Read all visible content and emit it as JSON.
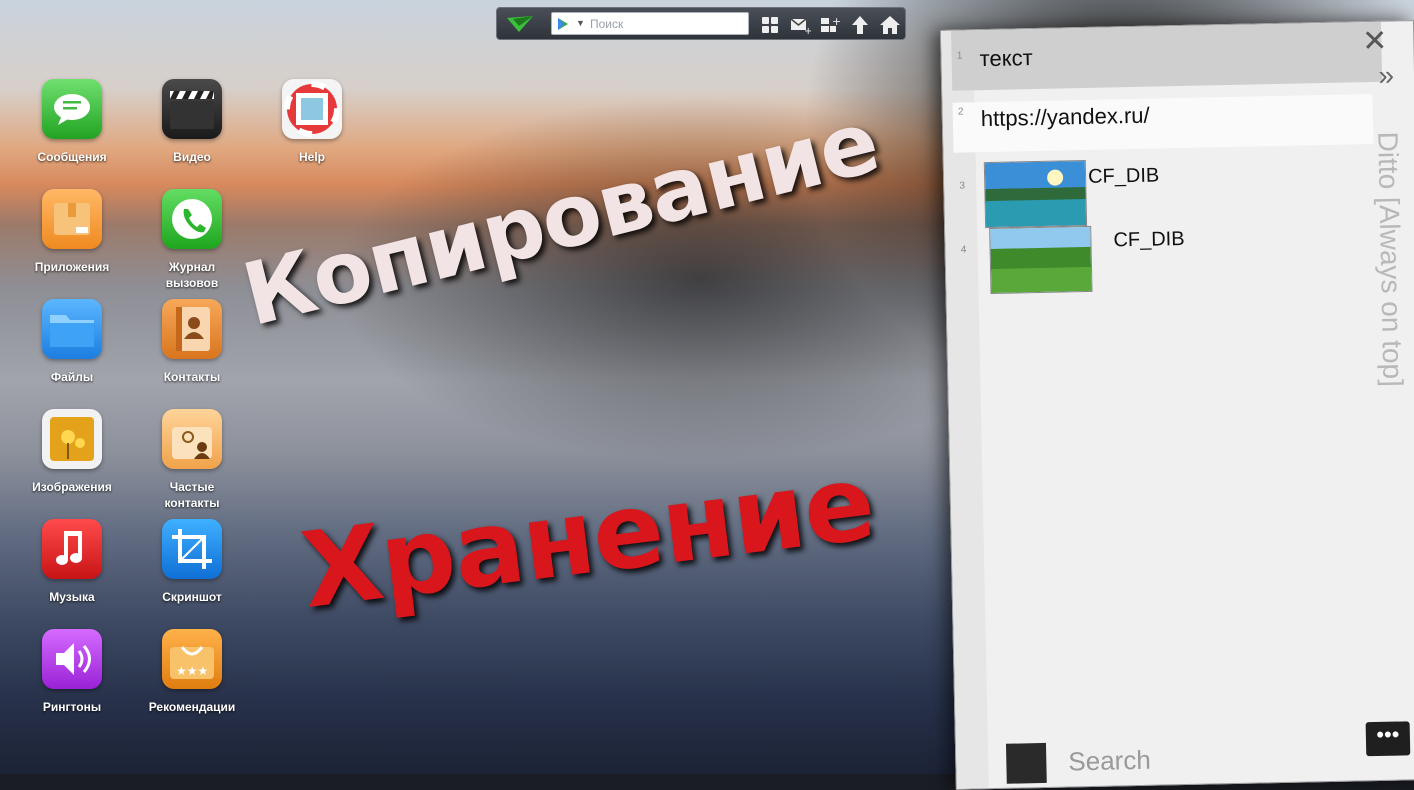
{
  "toolbar": {
    "search_placeholder": "Поиск"
  },
  "apps": [
    {
      "label": "Сообщения",
      "icon": "messages-icon"
    },
    {
      "label": "Видео",
      "icon": "video-clapper-icon"
    },
    {
      "label": "Help",
      "icon": "lifebuoy-icon"
    },
    {
      "label": "Приложения",
      "icon": "app-box-icon"
    },
    {
      "label": "Журнал\nвызовов",
      "icon": "phone-icon"
    },
    {
      "label": "Файлы",
      "icon": "folder-icon"
    },
    {
      "label": "Контакты",
      "icon": "contacts-book-icon"
    },
    {
      "label": "Изображения",
      "icon": "photos-icon"
    },
    {
      "label": "Частые\nконтакты",
      "icon": "frequent-contacts-icon"
    },
    {
      "label": "Музыка",
      "icon": "music-note-icon"
    },
    {
      "label": "Скриншот",
      "icon": "crop-icon"
    },
    {
      "label": "Рингтоны",
      "icon": "speaker-icon"
    },
    {
      "label": "Рекомендации",
      "icon": "basket-icon"
    }
  ],
  "headline": {
    "line1": "Копирование",
    "line2": "Хранение",
    "line1_color": "#f2e4e4",
    "line2_color": "#d8161c"
  },
  "ditto": {
    "title": "Ditto [Always on top]",
    "items": [
      {
        "num": "1",
        "text": "текст"
      },
      {
        "num": "2",
        "text": "https://yandex.ru/"
      },
      {
        "num": "3",
        "text": "CF_DIB"
      },
      {
        "num": "4",
        "text": "CF_DIB"
      }
    ],
    "search_placeholder": "Search",
    "more_label": "•••"
  }
}
